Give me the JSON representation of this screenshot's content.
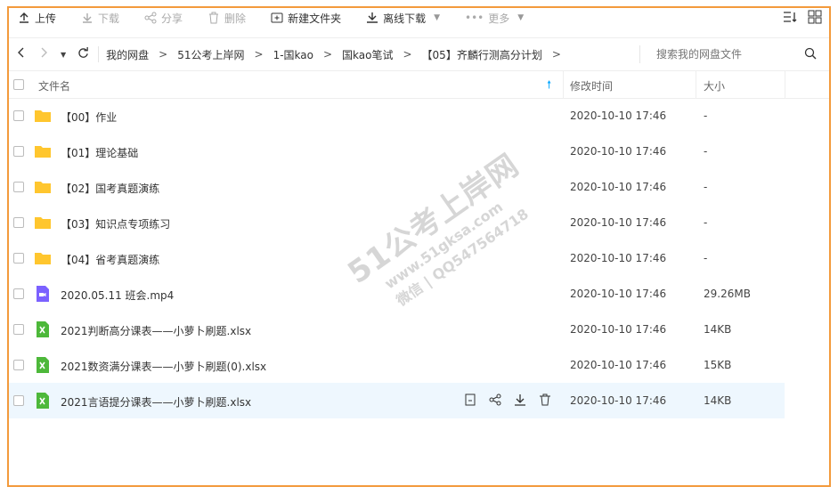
{
  "toolbar": {
    "upload": "上传",
    "download": "下载",
    "share": "分享",
    "delete": "删除",
    "new_folder": "新建文件夹",
    "offline_download": "离线下载",
    "more": "更多"
  },
  "nav": {
    "crumbs": [
      "我的网盘",
      "51公考上岸网",
      "1-国kao",
      "国kao笔试",
      "【05】齐麟行测高分计划"
    ],
    "search_placeholder": "搜索我的网盘文件"
  },
  "table": {
    "header": {
      "name": "文件名",
      "time": "修改时间",
      "size": "大小"
    },
    "rows": [
      {
        "type": "folder",
        "name": "【00】作业",
        "time": "2020-10-10 17:46",
        "size": "-"
      },
      {
        "type": "folder",
        "name": "【01】理论基础",
        "time": "2020-10-10 17:46",
        "size": "-"
      },
      {
        "type": "folder",
        "name": "【02】国考真题演练",
        "time": "2020-10-10 17:46",
        "size": "-"
      },
      {
        "type": "folder",
        "name": "【03】知识点专项练习",
        "time": "2020-10-10 17:46",
        "size": "-"
      },
      {
        "type": "folder",
        "name": "【04】省考真题演练",
        "time": "2020-10-10 17:46",
        "size": "-"
      },
      {
        "type": "video",
        "name": "2020.05.11 班会.mp4",
        "time": "2020-10-10 17:46",
        "size": "29.26MB"
      },
      {
        "type": "excel",
        "name": "2021判断高分课表——小萝卜刷题.xlsx",
        "time": "2020-10-10 17:46",
        "size": "14KB"
      },
      {
        "type": "excel",
        "name": "2021数资满分课表——小萝卜刷题(0).xlsx",
        "time": "2020-10-10 17:46",
        "size": "15KB"
      },
      {
        "type": "excel",
        "name": "2021言语提分课表——小萝卜刷题.xlsx",
        "time": "2020-10-10 17:46",
        "size": "14KB"
      }
    ]
  },
  "watermark": {
    "line1": "51公考上岸网",
    "line2": "www.51gksa.com",
    "line3": "微信 | QQ547564718"
  },
  "colors": {
    "accent": "#06a7ff",
    "folder": "#ffc62e",
    "excel": "#4db83a",
    "video": "#7b61ff",
    "frame": "#f39a3c"
  }
}
